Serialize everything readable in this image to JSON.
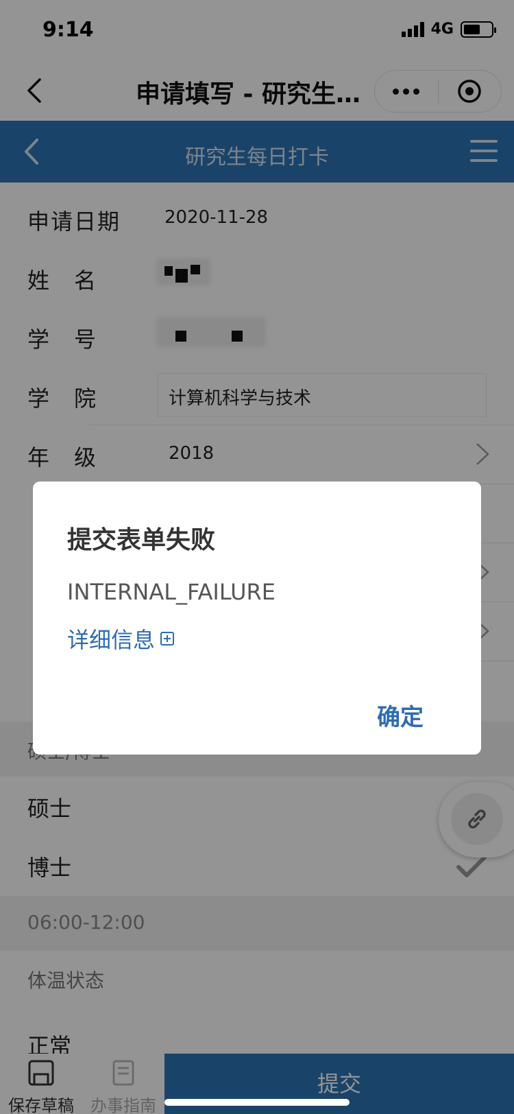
{
  "status_bar": {
    "time": "9:14",
    "network": "4G",
    "battery_level": 0.6
  },
  "title_bar": {
    "title": "申请填写 - 研究生…"
  },
  "app_header": {
    "title": "研究生每日打卡"
  },
  "form": {
    "rows": [
      {
        "label": "申请日期",
        "value": "2020-11-28"
      },
      {
        "label": "姓　名",
        "value": ""
      },
      {
        "label": "学　号",
        "value": ""
      },
      {
        "label": "学　院",
        "value": "计算机科学与技术"
      },
      {
        "label": "年　级",
        "value": "2018"
      }
    ],
    "degree_section": "硕士/博士",
    "degree_options": [
      {
        "label": "硕士",
        "selected": false
      },
      {
        "label": "博士",
        "selected": true
      }
    ],
    "time_section": "06:00-12:00",
    "temp_label": "体温状态",
    "temp_option": "正常"
  },
  "bottom_bar": {
    "save_draft": "保存草稿",
    "guide": "办事指南",
    "submit": "提交"
  },
  "dialog": {
    "title": "提交表单失败",
    "message": "INTERNAL_FAILURE",
    "detail_link": "详细信息",
    "ok": "确定"
  },
  "colors": {
    "accent": "#2e74b5",
    "link": "#2e6bb0"
  }
}
